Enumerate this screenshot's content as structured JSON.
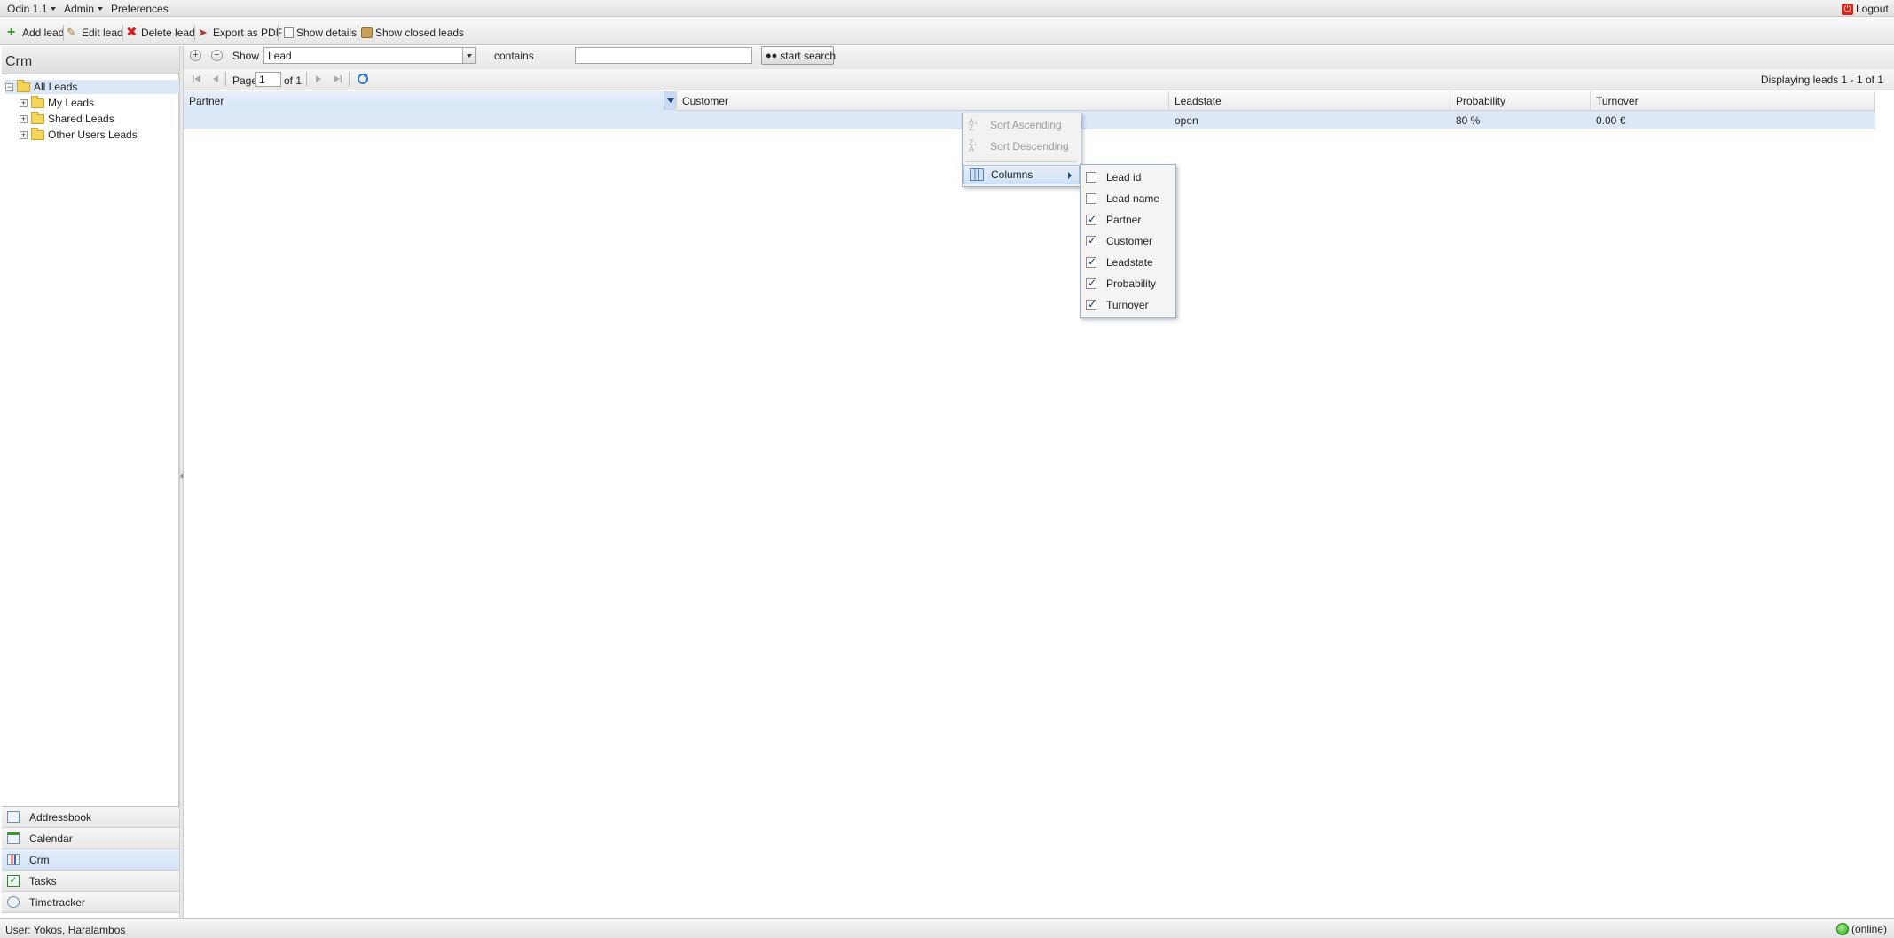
{
  "menubar": {
    "app": "Odin 1.1",
    "admin": "Admin",
    "preferences": "Preferences",
    "logout": "Logout"
  },
  "toolbar": {
    "add_lead": "Add lead",
    "edit_lead": "Edit lead",
    "delete_lead": "Delete lead",
    "export_pdf": "Export as PDF",
    "show_details": "Show details",
    "show_closed": "Show closed leads"
  },
  "sidebar": {
    "title": "Crm",
    "tree": [
      {
        "label": "All Leads"
      },
      {
        "label": "My Leads"
      },
      {
        "label": "Shared Leads"
      },
      {
        "label": "Other Users Leads"
      }
    ],
    "nav": [
      {
        "label": "Addressbook"
      },
      {
        "label": "Calendar"
      },
      {
        "label": "Crm"
      },
      {
        "label": "Tasks"
      },
      {
        "label": "Timetracker"
      }
    ]
  },
  "filter": {
    "show_label": "Show",
    "field_value": "Lead",
    "operator": "contains",
    "search_value": "",
    "search_button": "start search"
  },
  "pager": {
    "page_label": "Page",
    "page_value": "1",
    "of_label": "of 1",
    "display_info": "Displaying leads 1 - 1 of 1"
  },
  "grid": {
    "columns": [
      "Partner",
      "Customer",
      "Leadstate",
      "Probability",
      "Turnover"
    ],
    "rows": [
      {
        "partner": "",
        "customer": "",
        "leadstate": "open",
        "probability": "80 %",
        "turnover": "0.00 €"
      }
    ]
  },
  "context_menu": {
    "sort_asc": "Sort Ascending",
    "sort_desc": "Sort Descending",
    "columns": "Columns"
  },
  "columns_menu": [
    {
      "label": "Lead id",
      "checked": false
    },
    {
      "label": "Lead name",
      "checked": false
    },
    {
      "label": "Partner",
      "checked": true
    },
    {
      "label": "Customer",
      "checked": true
    },
    {
      "label": "Leadstate",
      "checked": true
    },
    {
      "label": "Probability",
      "checked": true
    },
    {
      "label": "Turnover",
      "checked": true
    }
  ],
  "status": {
    "user": "User: Yokos, Haralambos",
    "online": "(online)"
  }
}
